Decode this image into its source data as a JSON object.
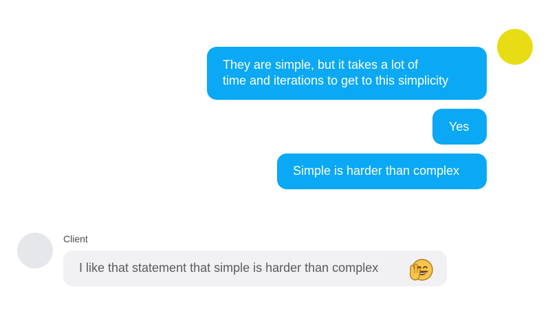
{
  "messages": [
    {
      "direction": "outgoing",
      "lines": [
        "They are simple, but it takes a lot of",
        "time and iterations to get to this simplicity"
      ]
    },
    {
      "direction": "outgoing",
      "text": "Yes"
    },
    {
      "direction": "outgoing",
      "text": "Simple is harder than complex"
    },
    {
      "direction": "incoming",
      "sender": "Client",
      "text": "I like that statement that simple is harder than complex",
      "emoji": "smiling-waving-hand-emoji"
    }
  ],
  "colors": {
    "outgoing_bubble": "#0aa8f5",
    "incoming_bubble": "#f1f1f4",
    "self_avatar": "#e8dc14",
    "client_avatar": "#e6e7eb"
  }
}
